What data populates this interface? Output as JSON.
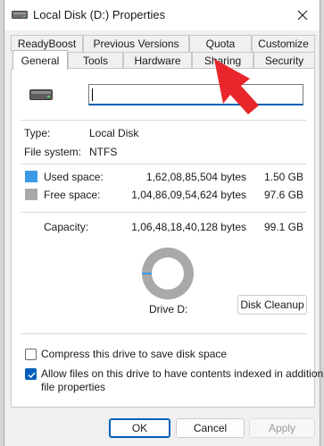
{
  "window": {
    "title": "Local Disk (D:) Properties"
  },
  "tabs": {
    "row1": [
      {
        "label": "ReadyBoost"
      },
      {
        "label": "Previous Versions"
      },
      {
        "label": "Quota"
      },
      {
        "label": "Customize"
      }
    ],
    "row2": [
      {
        "label": "General"
      },
      {
        "label": "Tools"
      },
      {
        "label": "Hardware"
      },
      {
        "label": "Sharing"
      },
      {
        "label": "Security"
      }
    ],
    "active": "General"
  },
  "general": {
    "drive_name_value": "",
    "type_label": "Type:",
    "type_value": "Local Disk",
    "fs_label": "File system:",
    "fs_value": "NTFS",
    "used_label": "Used space:",
    "used_bytes": "1,62,08,85,504 bytes",
    "used_size": "1.50 GB",
    "free_label": "Free space:",
    "free_bytes": "1,04,86,09,54,624 bytes",
    "free_size": "97.6 GB",
    "capacity_label": "Capacity:",
    "capacity_bytes": "1,06,48,18,40,128 bytes",
    "capacity_size": "99.1 GB",
    "drive_label": "Drive D:",
    "used_fraction": 0.015,
    "disk_cleanup_label": "Disk Cleanup",
    "compress_label": "Compress this drive to save disk space",
    "compress_checked": false,
    "index_label_line1": "Allow files on this drive to have contents indexed in addition to",
    "index_label_line2": "file properties",
    "index_checked": true
  },
  "colors": {
    "used": "#3c9be6",
    "free": "#a9a9a9",
    "accent": "#005fb8",
    "annotation_arrow": "#e8262b"
  },
  "buttons": {
    "ok": "OK",
    "cancel": "Cancel",
    "apply": "Apply"
  }
}
